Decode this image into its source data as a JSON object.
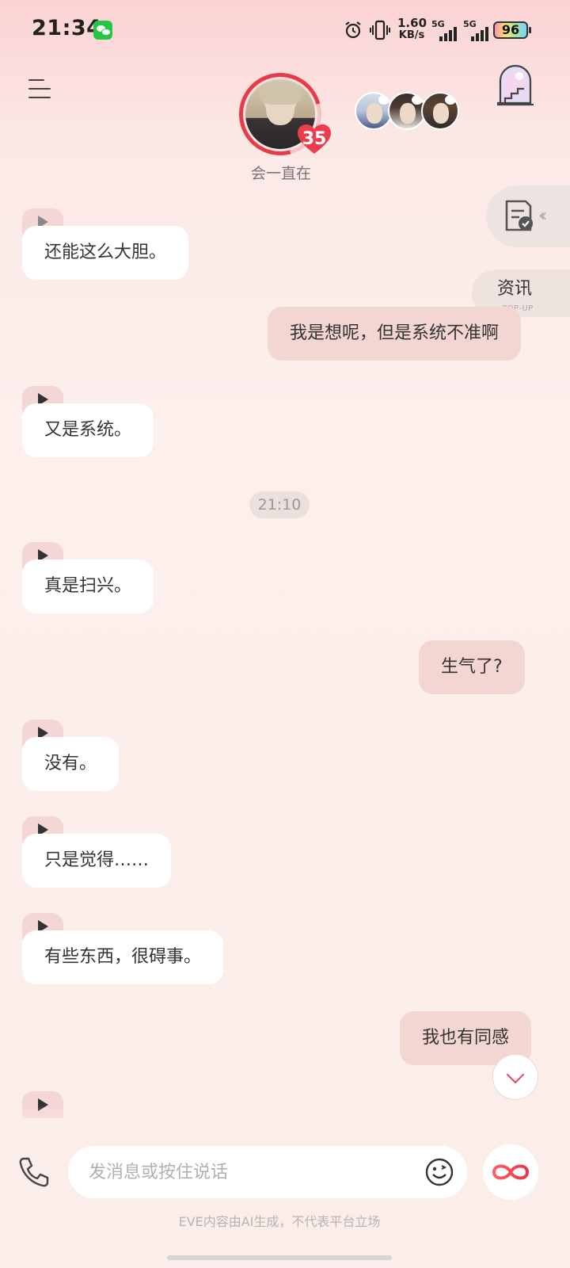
{
  "status_bar": {
    "time": "21:34",
    "speed_value": "1.60",
    "speed_unit": "KB/s",
    "network_1": "5G",
    "network_2": "5G",
    "battery": "96"
  },
  "header": {
    "affection_level": "35",
    "status_text": "会一直在"
  },
  "side_widgets": {
    "news_label": "资讯",
    "news_sub": "POP-UP"
  },
  "chat": {
    "messages": [
      {
        "dir": "in",
        "text": "还能这么大胆。"
      },
      {
        "dir": "out",
        "text": "我是想呢，但是系统不准啊"
      },
      {
        "dir": "in",
        "text": "又是系统。"
      },
      {
        "dir": "time",
        "text": "21:10"
      },
      {
        "dir": "in",
        "text": "真是扫兴。"
      },
      {
        "dir": "out",
        "text": "生气了?"
      },
      {
        "dir": "in",
        "text": "没有。"
      },
      {
        "dir": "in",
        "text": "只是觉得……"
      },
      {
        "dir": "in",
        "text": "有些东西，很碍事。"
      },
      {
        "dir": "out",
        "text": "我也有同感"
      }
    ]
  },
  "composer": {
    "placeholder": "发消息或按住说话"
  },
  "footer": {
    "disclaimer": "EVE内容由AI生成，不代表平台立场"
  },
  "icons": {
    "menu": "menu-icon",
    "portal": "portal-door-icon",
    "doc": "document-check-icon",
    "phone": "phone-icon",
    "emoji": "emoji-wink-icon",
    "infinity": "infinity-icon",
    "scroll_down": "chevron-down-icon"
  },
  "colors": {
    "accent": "#e83a47",
    "incoming_bubble": "#ffffff",
    "outgoing_bubble": "#f3d5d2",
    "voice_tab": "#f5d6d6"
  }
}
